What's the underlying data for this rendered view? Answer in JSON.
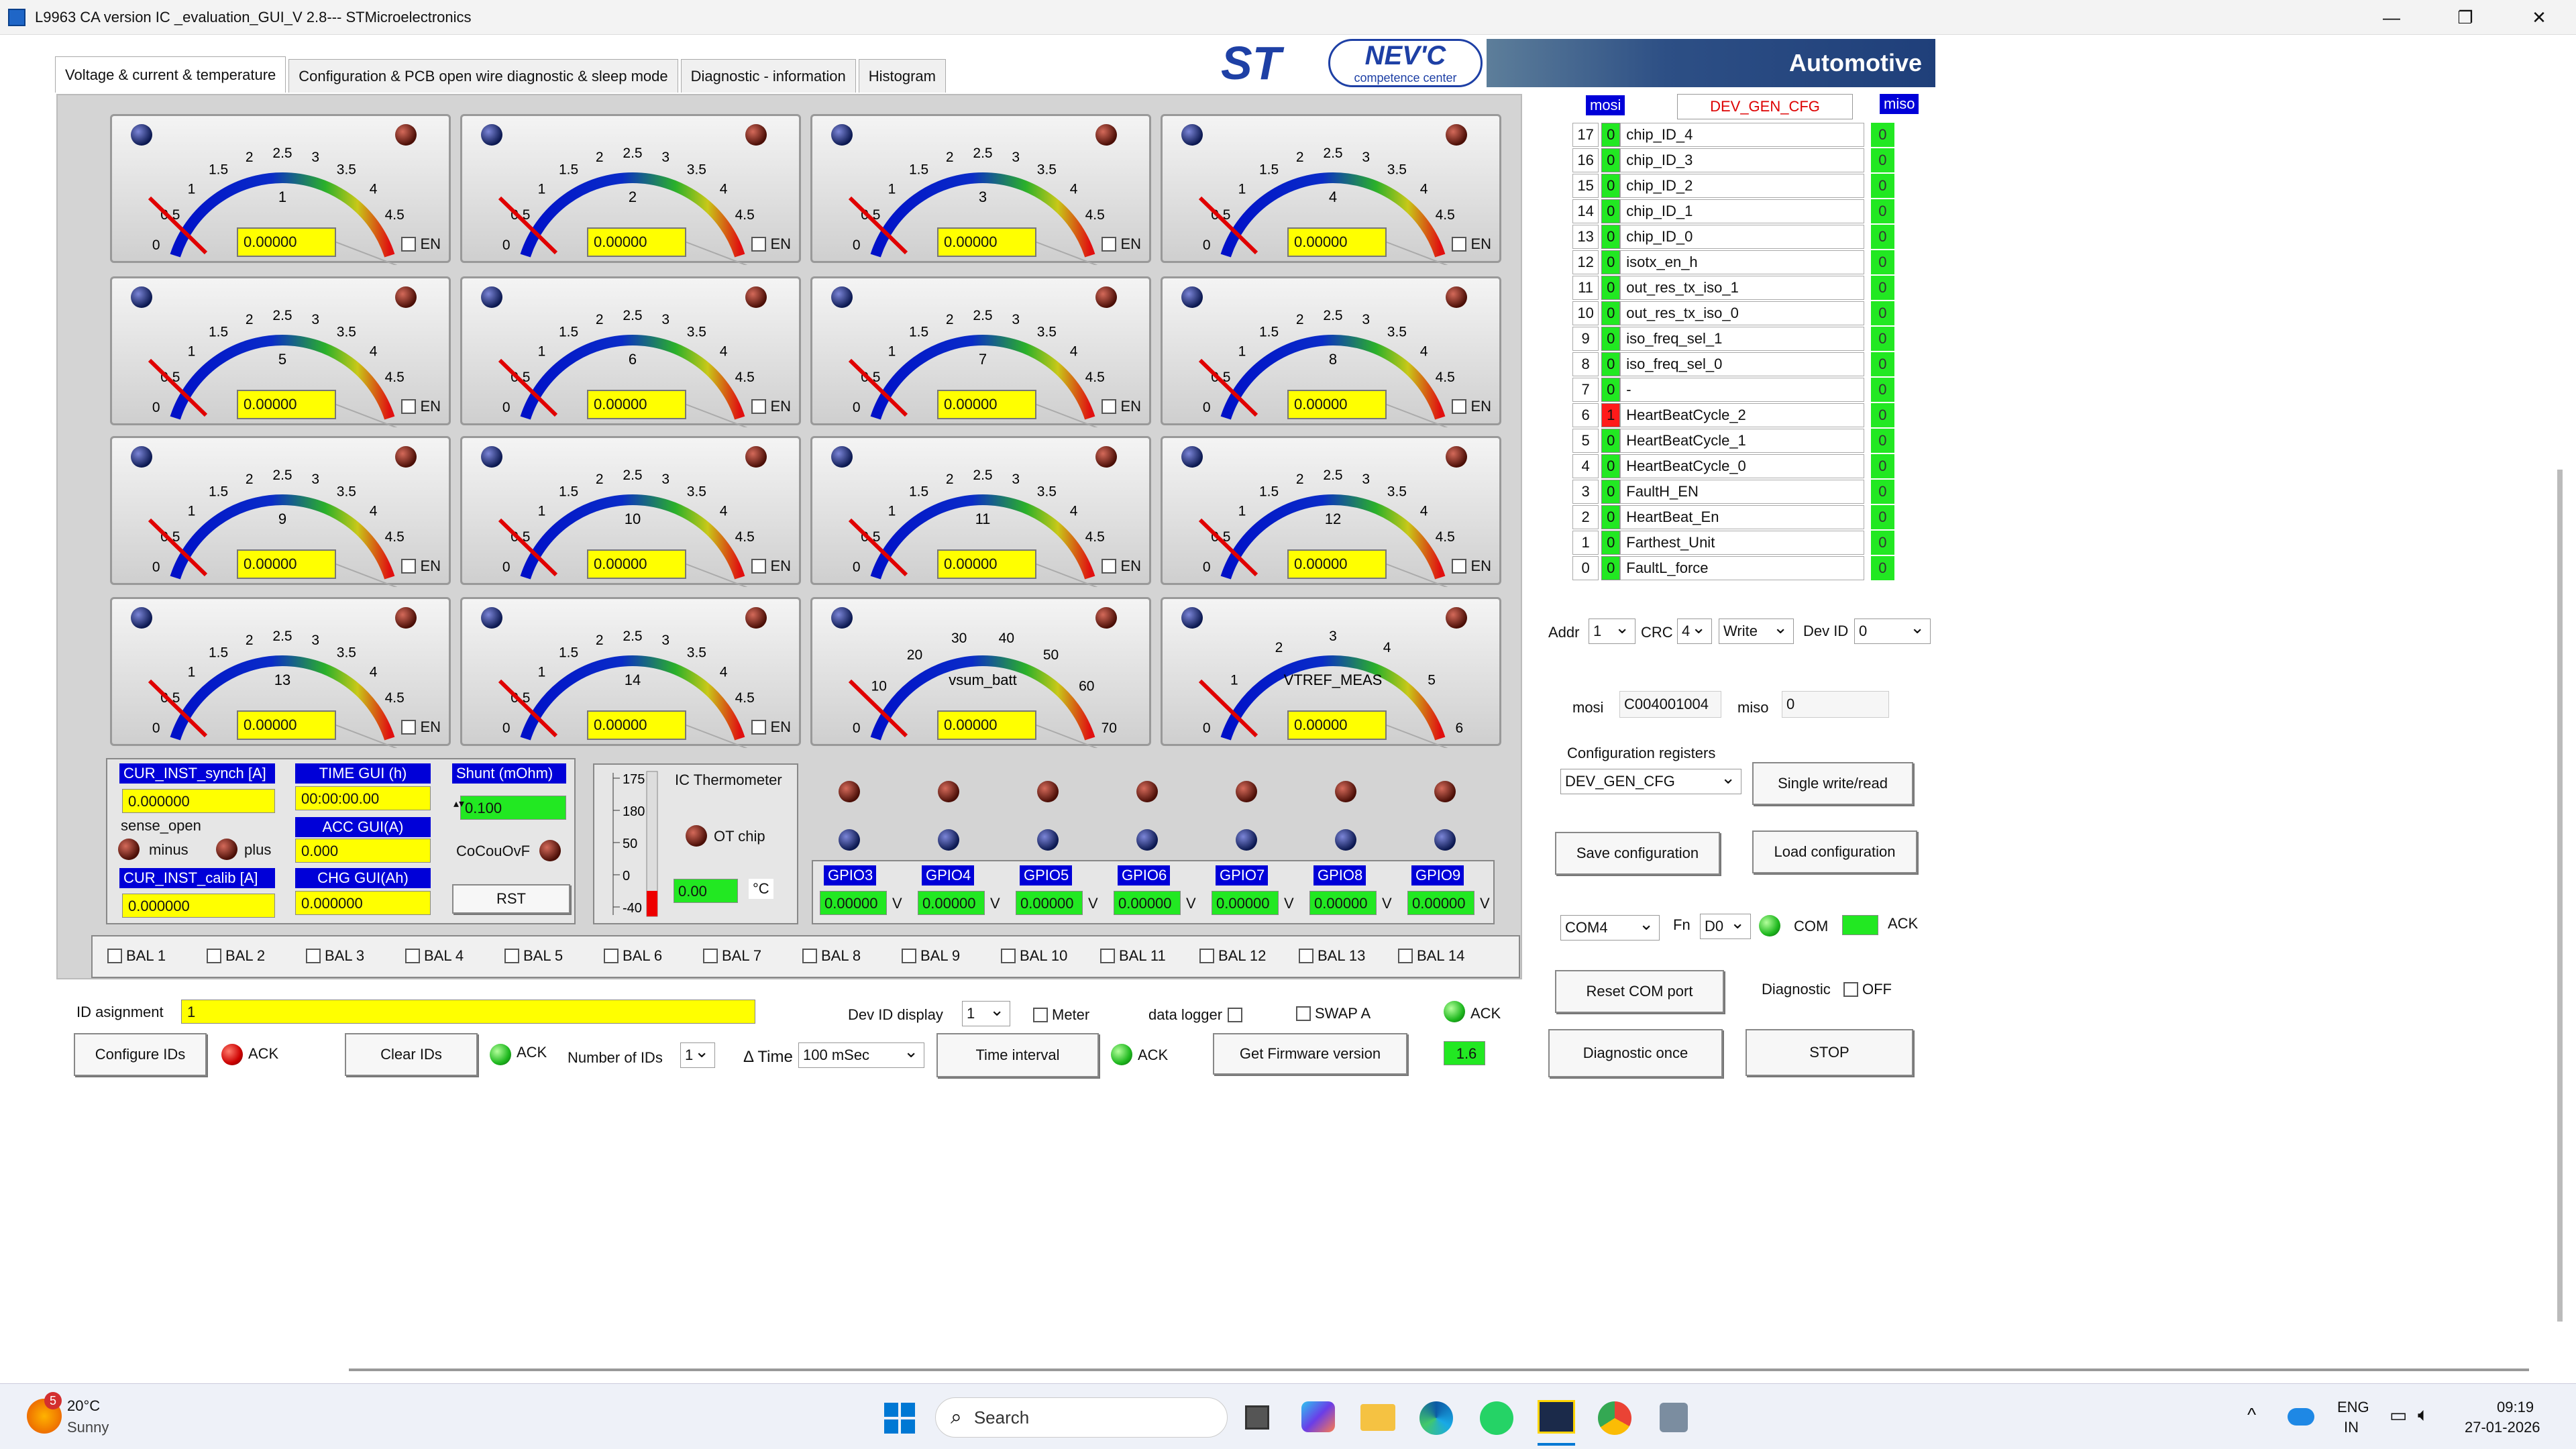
{
  "window": {
    "title": "L9963 CA version IC _evaluation_GUI_V 2.8--- STMicroelectronics"
  },
  "tabs": [
    "Voltage & current &  temperature",
    "Configuration & PCB open wire  diagnostic & sleep mode",
    "Diagnostic - information",
    "Histogram"
  ],
  "logo": {
    "st": "ST",
    "nevc": "NEV'C",
    "nevc_sub": "competence center",
    "automotive": "Automotive"
  },
  "gauge_ticks": [
    "0",
    "0.5",
    "1",
    "1.5",
    "2",
    "2.5",
    "3",
    "3.5",
    "4",
    "4.5",
    "5"
  ],
  "gauges": [
    {
      "label": "1",
      "value": "0.00000",
      "en": "EN"
    },
    {
      "label": "2",
      "value": "0.00000",
      "en": "EN"
    },
    {
      "label": "3",
      "value": "0.00000",
      "en": "EN"
    },
    {
      "label": "4",
      "value": "0.00000",
      "en": "EN"
    },
    {
      "label": "5",
      "value": "0.00000",
      "en": "EN"
    },
    {
      "label": "6",
      "value": "0.00000",
      "en": "EN"
    },
    {
      "label": "7",
      "value": "0.00000",
      "en": "EN"
    },
    {
      "label": "8",
      "value": "0.00000",
      "en": "EN"
    },
    {
      "label": "9",
      "value": "0.00000",
      "en": "EN"
    },
    {
      "label": "10",
      "value": "0.00000",
      "en": "EN"
    },
    {
      "label": "11",
      "value": "0.00000",
      "en": "EN"
    },
    {
      "label": "12",
      "value": "0.00000",
      "en": "EN"
    },
    {
      "label": "13",
      "value": "0.00000",
      "en": "EN"
    },
    {
      "label": "14",
      "value": "0.00000",
      "en": "EN"
    }
  ],
  "gauge_vsum": {
    "label": "vsum_batt",
    "value": "0.00000",
    "ticks": [
      "0",
      "10",
      "20",
      "30",
      "40",
      "50",
      "60",
      "70"
    ]
  },
  "gauge_vtref": {
    "label": "VTREF_MEAS",
    "value": "0.00000",
    "ticks": [
      "0",
      "1",
      "2",
      "3",
      "4",
      "5",
      "6"
    ]
  },
  "current": {
    "synch_label": "CUR_INST_synch [A]",
    "synch_value": "0.000000",
    "time_label": "TIME GUI (h)",
    "time_value": "00:00:00.00",
    "shunt_label": "Shunt (mOhm)",
    "shunt_value": "0.100",
    "sense_open": "sense_open",
    "minus": "minus",
    "plus": "plus",
    "acc_label": "ACC GUI(A)",
    "acc_value": "0.000",
    "cocouovf": "CoCouOvF",
    "calib_label": "CUR_INST_calib [A]",
    "calib_value": "0.000000",
    "chg_label": "CHG GUI(Ah)",
    "chg_value": "0.000000",
    "rst": "RST"
  },
  "thermo": {
    "title": "IC Thermometer",
    "otchip": "OT chip",
    "value": "0.00",
    "unit": "°C",
    "ticks": [
      "175",
      "180",
      "50",
      "0",
      "-40"
    ]
  },
  "gpio": [
    {
      "name": "GPIO3",
      "value": "0.00000",
      "unit": "V"
    },
    {
      "name": "GPIO4",
      "value": "0.00000",
      "unit": "V"
    },
    {
      "name": "GPIO5",
      "value": "0.00000",
      "unit": "V"
    },
    {
      "name": "GPIO6",
      "value": "0.00000",
      "unit": "V"
    },
    {
      "name": "GPIO7",
      "value": "0.00000",
      "unit": "V"
    },
    {
      "name": "GPIO8",
      "value": "0.00000",
      "unit": "V"
    },
    {
      "name": "GPIO9",
      "value": "0.00000",
      "unit": "V"
    }
  ],
  "bal": [
    "BAL 1",
    "BAL 2",
    "BAL 3",
    "BAL 4",
    "BAL 5",
    "BAL 6",
    "BAL 7",
    "BAL 8",
    "BAL 9",
    "BAL 10",
    "BAL 11",
    "BAL 12",
    "BAL 13",
    "BAL 14"
  ],
  "bottom": {
    "id_assign_label": "ID asignment",
    "id_assign_value": "1",
    "devid_display_label": "Dev ID display",
    "devid_display_value": "1",
    "meter": "Meter",
    "datalogger": "data logger",
    "swap": "SWAP A",
    "ack": "ACK",
    "configure_ids": "Configure IDs",
    "clear_ids": "Clear IDs",
    "num_ids_label": "Number of IDs",
    "num_ids_value": "1",
    "dtime_label": "Δ Time",
    "dtime_value": "100   mSec",
    "time_interval": "Time interval",
    "firmware": "Get Firmware version",
    "fw_value": "1.6"
  },
  "register": {
    "mosi_label": "mosi",
    "name": "DEV_GEN_CFG",
    "miso_label": "miso",
    "rows": [
      {
        "n": "17",
        "m": "0",
        "name": "chip_ID_4",
        "mi": "0"
      },
      {
        "n": "16",
        "m": "0",
        "name": "chip_ID_3",
        "mi": "0"
      },
      {
        "n": "15",
        "m": "0",
        "name": "chip_ID_2",
        "mi": "0"
      },
      {
        "n": "14",
        "m": "0",
        "name": "chip_ID_1",
        "mi": "0"
      },
      {
        "n": "13",
        "m": "0",
        "name": "chip_ID_0",
        "mi": "0"
      },
      {
        "n": "12",
        "m": "0",
        "name": "isotx_en_h",
        "mi": "0"
      },
      {
        "n": "11",
        "m": "0",
        "name": "out_res_tx_iso_1",
        "mi": "0"
      },
      {
        "n": "10",
        "m": "0",
        "name": "out_res_tx_iso_0",
        "mi": "0"
      },
      {
        "n": "9",
        "m": "0",
        "name": "iso_freq_sel_1",
        "mi": "0"
      },
      {
        "n": "8",
        "m": "0",
        "name": "iso_freq_sel_0",
        "mi": "0"
      },
      {
        "n": "7",
        "m": "0",
        "name": "-",
        "mi": "0"
      },
      {
        "n": "6",
        "m": "1",
        "name": "HeartBeatCycle_2",
        "mi": "0"
      },
      {
        "n": "5",
        "m": "0",
        "name": "HeartBeatCycle_1",
        "mi": "0"
      },
      {
        "n": "4",
        "m": "0",
        "name": "HeartBeatCycle_0",
        "mi": "0"
      },
      {
        "n": "3",
        "m": "0",
        "name": "FaultH_EN",
        "mi": "0"
      },
      {
        "n": "2",
        "m": "0",
        "name": "HeartBeat_En",
        "mi": "0"
      },
      {
        "n": "1",
        "m": "0",
        "name": "Farthest_Unit",
        "mi": "0"
      },
      {
        "n": "0",
        "m": "0",
        "name": "FaultL_force",
        "mi": "0"
      }
    ]
  },
  "right": {
    "addr_label": "Addr",
    "addr_value": "1",
    "crc_label": "CRC",
    "crc_value": "4",
    "mode": "Write",
    "devid_label": "Dev ID",
    "devid_value": "0",
    "mosi_label": "mosi",
    "mosi_value": "C004001004",
    "miso_label": "miso",
    "miso_value": "0",
    "cfgreg_label": "Configuration registers",
    "cfgreg_value": "DEV_GEN_CFG",
    "single": "Single write/read",
    "save": "Save configuration",
    "load": "Load configuration",
    "com_value": "COM4",
    "fn_label": "Fn",
    "fn_value": "D0",
    "com_label": "COM",
    "ack_label": "ACK",
    "reset_com": "Reset  COM port",
    "diagnostic_label": "Diagnostic",
    "diagnostic_state": "OFF",
    "diag_once": "Diagnostic once",
    "stop": "STOP"
  },
  "taskbar": {
    "temp": "20°C",
    "weather": "Sunny",
    "badge": "5",
    "search": "Search",
    "lang1": "ENG",
    "lang2": "IN",
    "time": "09:19",
    "date": "27-01-2026"
  }
}
